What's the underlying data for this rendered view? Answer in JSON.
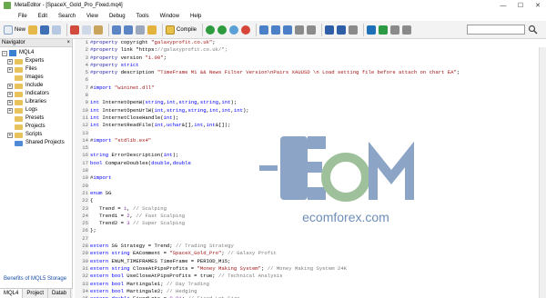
{
  "window": {
    "title": "MetaEditor - [SpaceX_Gold_Pro_Fixed.mq4]",
    "controls": {
      "minimize": "—",
      "maximize": "☐",
      "close": "✕"
    }
  },
  "menu": [
    "File",
    "Edit",
    "Search",
    "View",
    "Debug",
    "Tools",
    "Window",
    "Help"
  ],
  "toolbar": {
    "new_label": "New",
    "compile_label": "Compile",
    "search_placeholder": ""
  },
  "navigator": {
    "title": "Navigator",
    "root": "MQL4",
    "items": [
      "Experts",
      "Files",
      "Images",
      "Include",
      "Indicators",
      "Libraries",
      "Logs",
      "Presets",
      "Projects",
      "Scripts",
      "Shared Projects"
    ],
    "benefits": "Benefits of MQL5 Storage",
    "tabs": [
      "MQL4",
      "Project",
      "Datab"
    ]
  },
  "watermark": {
    "brand": "ecomforex.com"
  },
  "code": {
    "lines": [
      {
        "n": "1",
        "t": "#property copyright \"galaxyprofit.co.uk\";"
      },
      {
        "n": "2",
        "t": "#property link \"https://galaxyprofit.co.uk/\";"
      },
      {
        "n": "3",
        "t": "#property version \"1.00\";"
      },
      {
        "n": "4",
        "t": "#property strict"
      },
      {
        "n": "5",
        "t": "#property description \"TimeFrame M1 && News Filter Version\\nPairs XAUUSD \\n Load setting file before attach on chart EA\";"
      },
      {
        "n": "6",
        "t": ""
      },
      {
        "n": "7",
        "t": "#import \"wininet.dll\""
      },
      {
        "n": "8",
        "t": ""
      },
      {
        "n": "9",
        "t": "int InternetOpenW(string,int,string,string,int);"
      },
      {
        "n": "10",
        "t": "int InternetOpenUrlW(int,string,string,int,int,int);"
      },
      {
        "n": "11",
        "t": "int InternetCloseHandle(int);"
      },
      {
        "n": "12",
        "t": "int InternetReadFile(int,uchar&[],int,int&[]);"
      },
      {
        "n": "13",
        "t": ""
      },
      {
        "n": "14",
        "t": "#import \"stdlib.ex4\""
      },
      {
        "n": "15",
        "t": ""
      },
      {
        "n": "16",
        "t": "string ErrorDescription(int);"
      },
      {
        "n": "17",
        "t": "bool CompareDoubles(double,double"
      },
      {
        "n": "18",
        "t": ""
      },
      {
        "n": "19",
        "t": "#import"
      },
      {
        "n": "20",
        "t": ""
      },
      {
        "n": "21",
        "t": "enum SG"
      },
      {
        "n": "22",
        "t": "{"
      },
      {
        "n": "23",
        "t": "   Trend = 1, // Scalping"
      },
      {
        "n": "24",
        "t": "   Trend1 = 2, // Fast Scalping"
      },
      {
        "n": "25",
        "t": "   Trend2 = 3 // Super Scalping"
      },
      {
        "n": "26",
        "t": "};"
      },
      {
        "n": "27",
        "t": ""
      },
      {
        "n": "28",
        "t": "extern SG Strategy = Trend; // Trading Strategy"
      },
      {
        "n": "29",
        "t": "extern string EAComment = \"SpaceX_Gold_Pro\"; // Galaxy Profit"
      },
      {
        "n": "30",
        "t": "extern ENUM_TIMEFRAMES TimeFrame = PERIOD_M15;"
      },
      {
        "n": "31",
        "t": "extern string CloseAtPipsProfits = \"Money Making System\"; // Money Making System 24K"
      },
      {
        "n": "32",
        "t": "extern bool UseCloseAtPipsProfits = true; // Technical Analysis"
      },
      {
        "n": "33",
        "t": "extern bool Martingale1; // Day Trading"
      },
      {
        "n": "34",
        "t": "extern bool Martingale2; // Hedging"
      },
      {
        "n": "35",
        "t": "extern double FixedLots = 0.01; // Fixed Lot Size"
      }
    ]
  }
}
